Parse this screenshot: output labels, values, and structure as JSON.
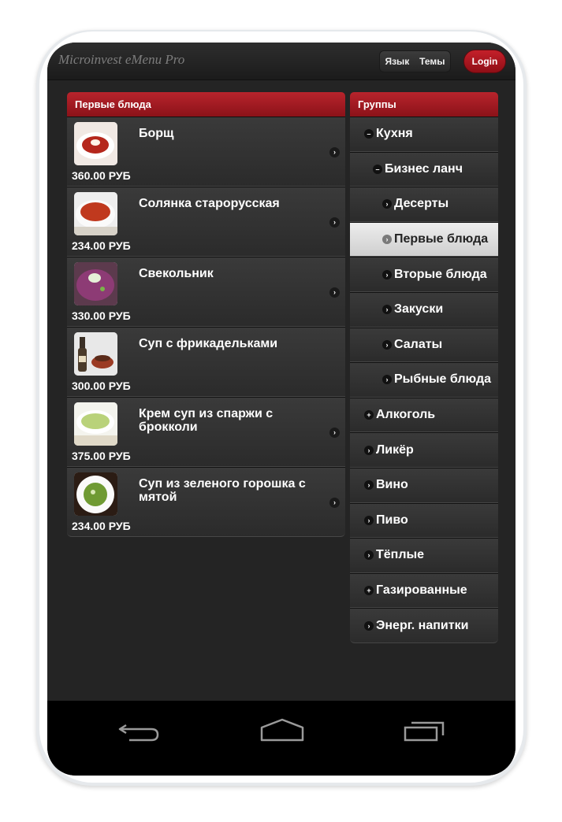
{
  "app": {
    "title": "Microinvest eMenu Pro"
  },
  "header": {
    "language_label": "Язык",
    "themes_label": "Темы",
    "login_label": "Login"
  },
  "dishes_panel": {
    "title": "Первые блюда",
    "items": [
      {
        "name": "Борщ",
        "price": "360.00 РУБ"
      },
      {
        "name": "Солянка старорусская",
        "price": "234.00 РУБ"
      },
      {
        "name": "Свекольник",
        "price": "330.00 РУБ"
      },
      {
        "name": "Суп с фрикадельками",
        "price": "300.00 РУБ"
      },
      {
        "name": "Крем суп из спаржи с брокколи",
        "price": "375.00 РУБ"
      },
      {
        "name": "Суп из зеленого горошка с мятой",
        "price": "234.00 РУБ"
      }
    ]
  },
  "groups_panel": {
    "title": "Группы",
    "items": [
      {
        "label": "Кухня",
        "icon": "minus-icon"
      },
      {
        "label": "Бизнес ланч",
        "icon": "minus-icon"
      },
      {
        "label": "Десерты",
        "icon": "chevron-right-icon"
      },
      {
        "label": "Первые блюда",
        "icon": "chevron-right-icon",
        "selected": true
      },
      {
        "label": "Вторые блюда",
        "icon": "chevron-right-icon"
      },
      {
        "label": "Закуски",
        "icon": "chevron-right-icon"
      },
      {
        "label": "Салаты",
        "icon": "chevron-right-icon"
      },
      {
        "label": "Рыбные блюда",
        "icon": "chevron-right-icon"
      },
      {
        "label": "Алкоголь",
        "icon": "plus-icon"
      },
      {
        "label": "Ликёр",
        "icon": "chevron-right-icon"
      },
      {
        "label": "Вино",
        "icon": "chevron-right-icon"
      },
      {
        "label": "Пиво",
        "icon": "chevron-right-icon"
      },
      {
        "label": "Тёплые",
        "icon": "chevron-right-icon"
      },
      {
        "label": "Газированные",
        "icon": "plus-icon"
      },
      {
        "label": "Энерг. напитки",
        "icon": "chevron-right-icon"
      }
    ]
  },
  "colors": {
    "accent": "#b8242c",
    "background": "#242424",
    "selected_group": "#e0e0e0"
  },
  "system_nav": {
    "buttons": [
      "back-icon",
      "home-icon",
      "recent-apps-icon"
    ]
  }
}
